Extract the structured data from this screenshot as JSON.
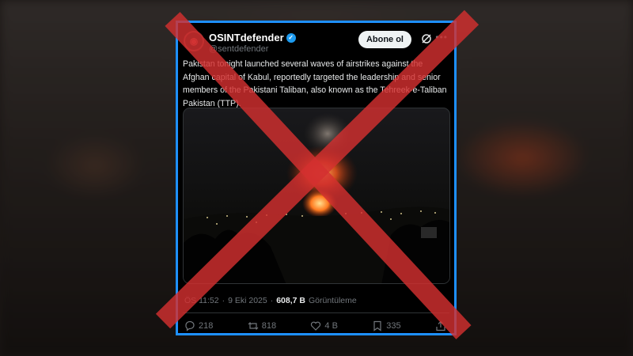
{
  "post": {
    "author_name": "OSINTdefender",
    "handle": "@sentdefender",
    "follow_label": "Abone ol",
    "text": "Pakistan tonight launched several waves of airstrikes against the Afghan capital of Kabul, reportedly targeted the leadership and senior members of the Pakistani Taliban, also known as the Tehreek-e-Taliban Pakistan (TTP).",
    "time": "ÖS 11:52",
    "separator": "·",
    "date": "9 Eki 2025",
    "views_count": "608,7 B",
    "views_label": "Görüntüleme"
  },
  "actions": {
    "replies": "218",
    "reposts": "818",
    "likes": "4 B",
    "bookmarks": "335"
  },
  "icons": {
    "verified": "verified-badge-icon",
    "grok": "grok-icon",
    "more": "more-icon",
    "reply": "reply-icon",
    "repost": "repost-icon",
    "like": "heart-icon",
    "bookmark": "bookmark-icon",
    "share": "share-icon"
  },
  "colors": {
    "frame": "#1e90ff",
    "cross": "#d32f2f",
    "verified": "#1d9bf0"
  }
}
